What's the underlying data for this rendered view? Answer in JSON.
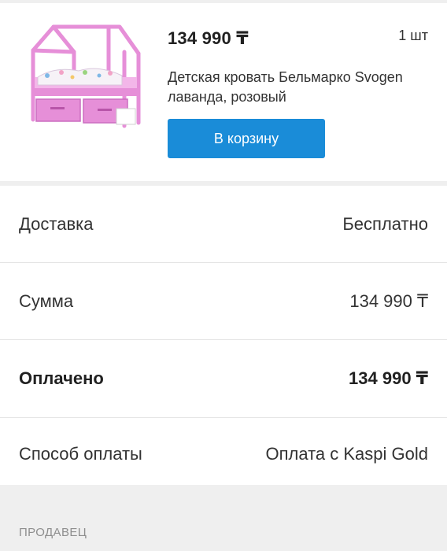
{
  "product": {
    "price": "134 990 ₸",
    "quantity": "1 шт",
    "title": "Детская кровать Бельмарко Svogen лаванда, розовый",
    "cart_button": "В корзину",
    "image_icon": "bed-house-icon"
  },
  "details": {
    "rows": [
      {
        "label": "Доставка",
        "value": "Бесплатно"
      },
      {
        "label": "Сумма",
        "value": "134 990 ₸"
      },
      {
        "label": "Оплачено",
        "value": "134 990 ₸"
      },
      {
        "label": "Способ оплаты",
        "value": "Оплата с Kaspi Gold"
      }
    ]
  },
  "seller": {
    "section_label": "ПРОДАВЕЦ"
  },
  "colors": {
    "accent": "#1a8cd8",
    "background": "#efefef",
    "card": "#ffffff",
    "bed_frame": "#e68fd8"
  }
}
